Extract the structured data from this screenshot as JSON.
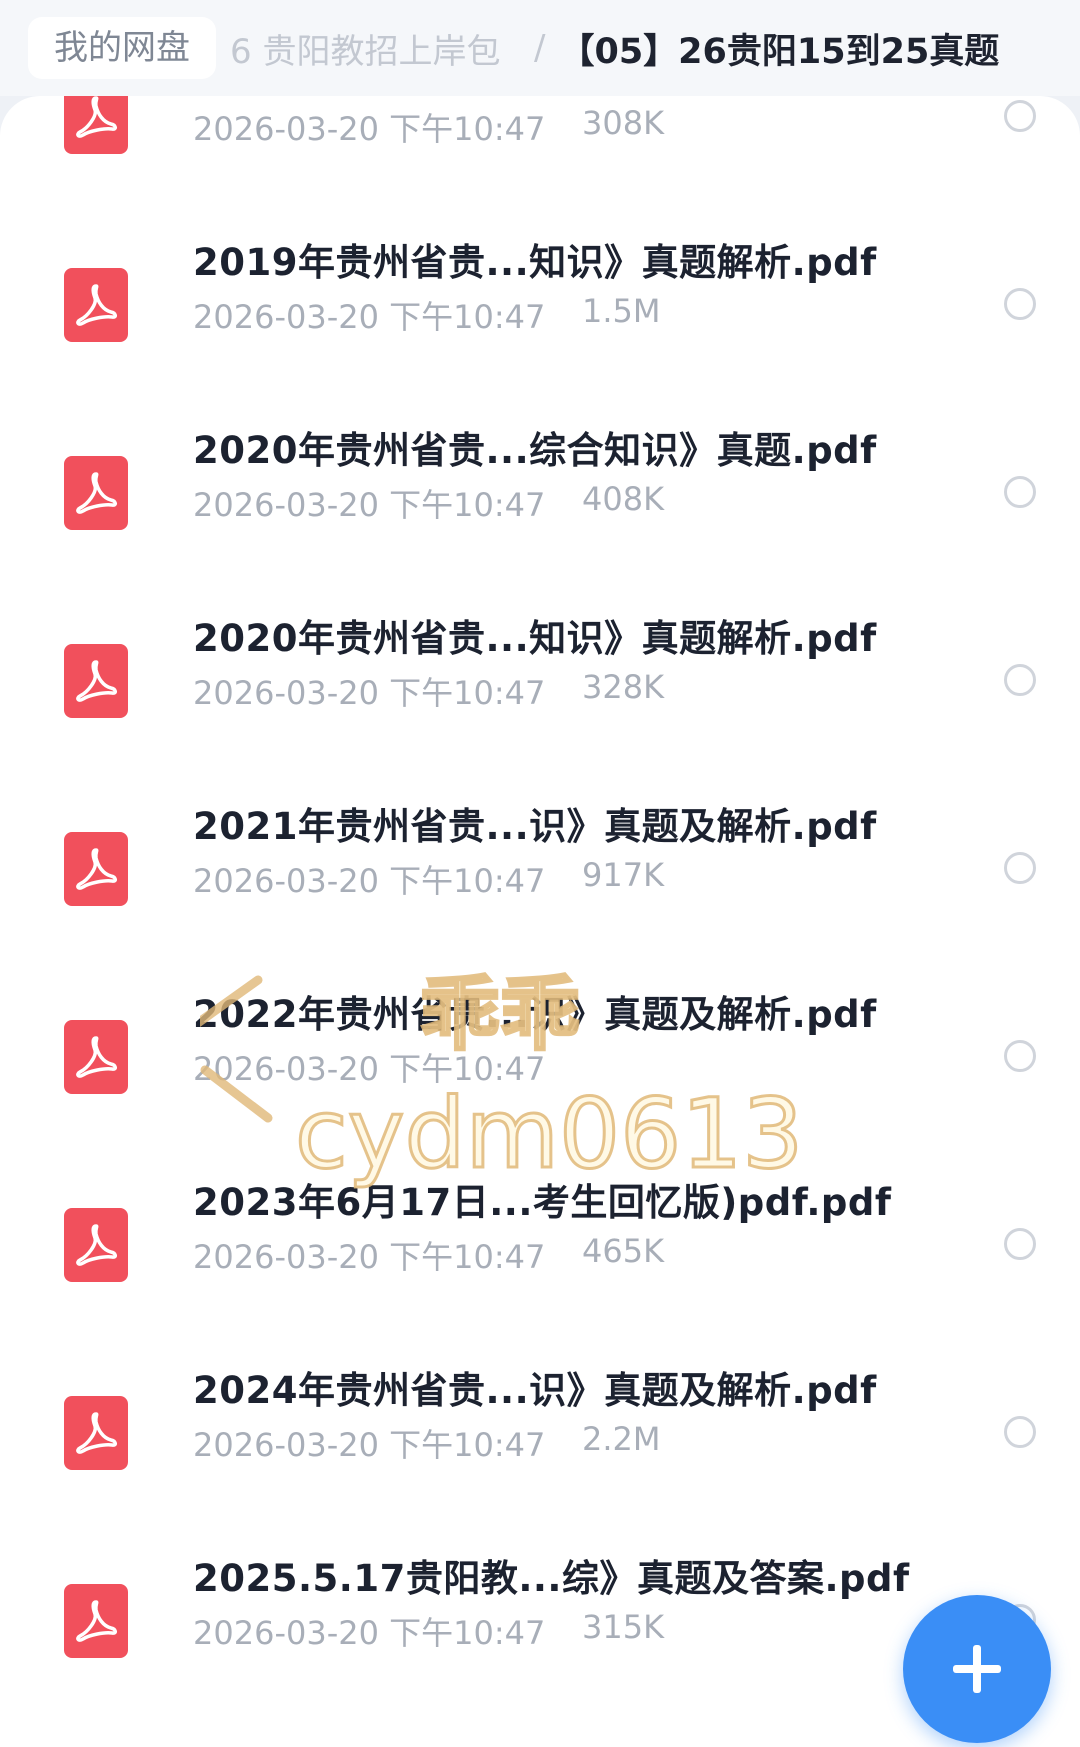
{
  "breadcrumb": {
    "root": "我的网盘",
    "middle": "6 贵阳教招上岸包",
    "separator": "/",
    "current": "【05】26贵阳15到25真题"
  },
  "files": [
    {
      "name": "",
      "date": "2026-03-20 下午10:47",
      "size": "308K",
      "icon": "pdf-icon"
    },
    {
      "name": "2019年贵州省贵...知识》真题解析.pdf",
      "date": "2026-03-20 下午10:47",
      "size": "1.5M",
      "icon": "pdf-icon"
    },
    {
      "name": "2020年贵州省贵...综合知识》真题.pdf",
      "date": "2026-03-20 下午10:47",
      "size": "408K",
      "icon": "pdf-icon"
    },
    {
      "name": "2020年贵州省贵...知识》真题解析.pdf",
      "date": "2026-03-20 下午10:47",
      "size": "328K",
      "icon": "pdf-icon"
    },
    {
      "name": "2021年贵州省贵...识》真题及解析.pdf",
      "date": "2026-03-20 下午10:47",
      "size": "917K",
      "icon": "pdf-icon"
    },
    {
      "name": "2022年贵州省贵...识》真题及解析.pdf",
      "date": "2026-03-20 下午10:47",
      "size": "",
      "icon": "pdf-icon"
    },
    {
      "name": "2023年6月17日...考生回忆版)pdf.pdf",
      "date": "2026-03-20 下午10:47",
      "size": "465K",
      "icon": "pdf-icon"
    },
    {
      "name": "2024年贵州省贵...识》真题及解析.pdf",
      "date": "2026-03-20 下午10:47",
      "size": "2.2M",
      "icon": "pdf-icon"
    },
    {
      "name": "2025.5.17贵阳教...综》真题及答案.pdf",
      "date": "2026-03-20 下午10:47",
      "size": "315K",
      "icon": "pdf-icon"
    }
  ],
  "fab": {
    "icon": "plus-icon"
  },
  "watermark": {
    "top": "乖乖",
    "bottom": "cydm0613"
  },
  "colors": {
    "pdf_red": "#f1505c",
    "fab_blue": "#3a8ef6",
    "title_text": "#1c2230",
    "meta_text": "#a8aeb8"
  }
}
